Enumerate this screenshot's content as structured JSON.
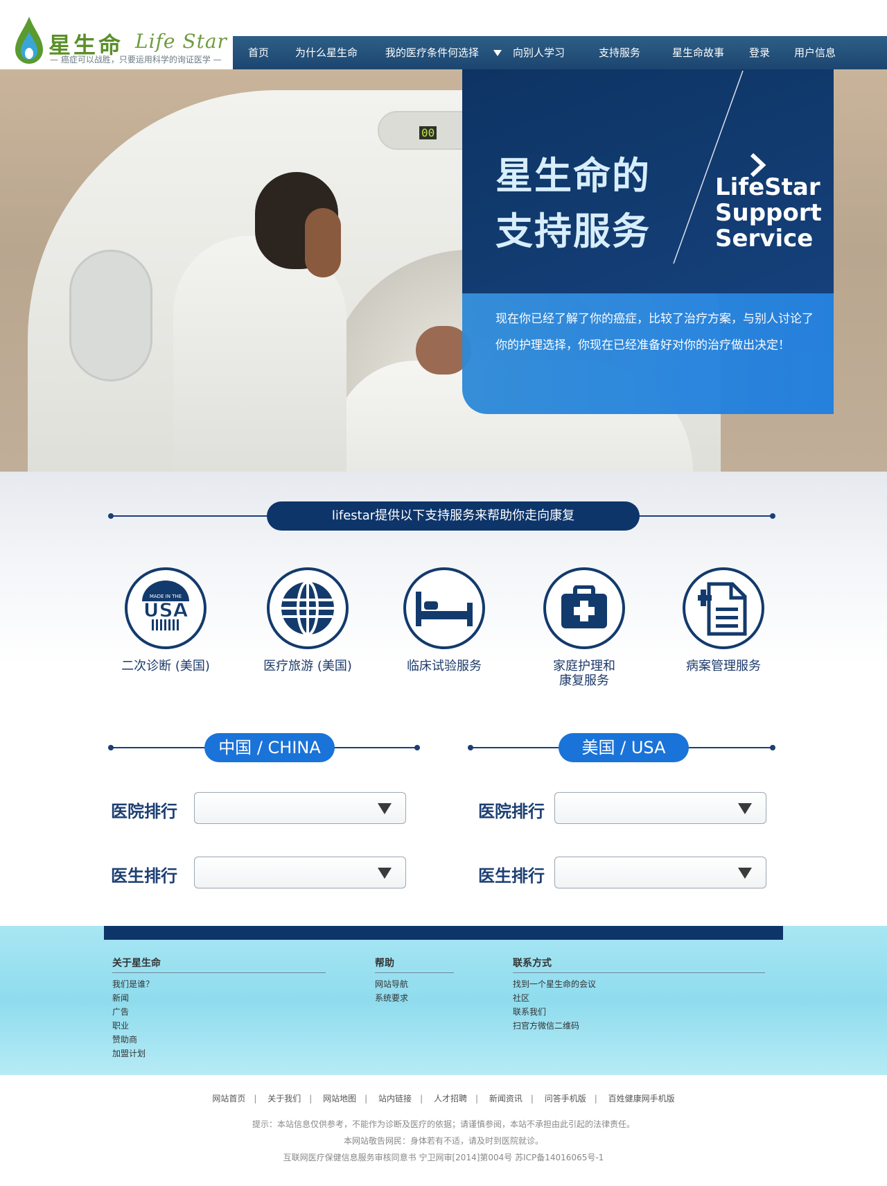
{
  "logo": {
    "brand_cn": "星生命",
    "brand_en": "Life Star",
    "tagline": "— 癌症可以战胜，只要运用科学的询证医学 —"
  },
  "nav": {
    "items": [
      "首页",
      "为什么星生命",
      "我的医疗条件何选择",
      "向别人学习",
      "支持服务",
      "星生命故事",
      "登录",
      "用户信息"
    ]
  },
  "hero": {
    "display_digits": "00",
    "title_cn_line1": "星生命的",
    "title_cn_line2": "支持服务",
    "title_en_line1": "LifeStar",
    "title_en_line2": "Support",
    "title_en_line3": "Service",
    "description": "现在你已经了解了你的癌症，比较了治疗方案，与别人讨论了你的护理选择，你现在已经准备好对你的治疗做出决定！"
  },
  "services": {
    "heading": "lifestar提供以下支持服务来帮助你走向康复",
    "items": [
      {
        "label_line1": "二次诊断 (美国)",
        "label_line2": "",
        "icon": "usa-badge-icon",
        "badge_text": "USA",
        "badge_small": "MADE IN THE"
      },
      {
        "label_line1": "医疗旅游 (美国)",
        "label_line2": "",
        "icon": "globe-icon"
      },
      {
        "label_line1": "临床试验服务",
        "label_line2": "",
        "icon": "bed-icon"
      },
      {
        "label_line1": "家庭护理和",
        "label_line2": "康复服务",
        "icon": "medical-kit-icon"
      },
      {
        "label_line1": "病案管理服务",
        "label_line2": "",
        "icon": "medical-record-icon"
      }
    ]
  },
  "rankings": {
    "china": {
      "title": "中国 / CHINA",
      "hospital_label": "医院排行",
      "doctor_label": "医生排行"
    },
    "usa": {
      "title": "美国 / USA",
      "hospital_label": "医院排行",
      "doctor_label": "医生排行"
    }
  },
  "footer": {
    "about": {
      "heading": "关于星生命",
      "links": [
        "我们是谁？",
        "新闻",
        "广告",
        "职业",
        "赞助商",
        "加盟计划"
      ]
    },
    "help": {
      "heading": "帮助",
      "links": [
        "网站导航",
        "系统要求"
      ]
    },
    "contact": {
      "heading": "联系方式",
      "links": [
        "找到一个星生命的会议",
        "社区",
        "联系我们",
        "扫官方微信二维码"
      ]
    },
    "bottom_links": [
      "网站首页",
      "关于我们",
      "网站地图",
      "站内链接",
      "人才招聘",
      "新闻资讯",
      "问答手机版",
      "百姓健康网手机版"
    ],
    "notice1": "提示：本站信息仅供参考，不能作为诊断及医疗的依据；请谨慎参阅，本站不承担由此引起的法律责任。",
    "notice2": "本网站敬告网民：身体若有不适，请及时到医院就诊。",
    "notice3": "互联网医疗保健信息服务审核同意书 宁卫网审[2014]第004号   苏ICP备14016065号-1"
  },
  "colors": {
    "navy": "#0e356a",
    "accent_blue": "#1a73d8",
    "nav_bg": "#1c4570",
    "brand_green": "#5a8f2a",
    "footer_cyan": "#a8e6f3"
  }
}
